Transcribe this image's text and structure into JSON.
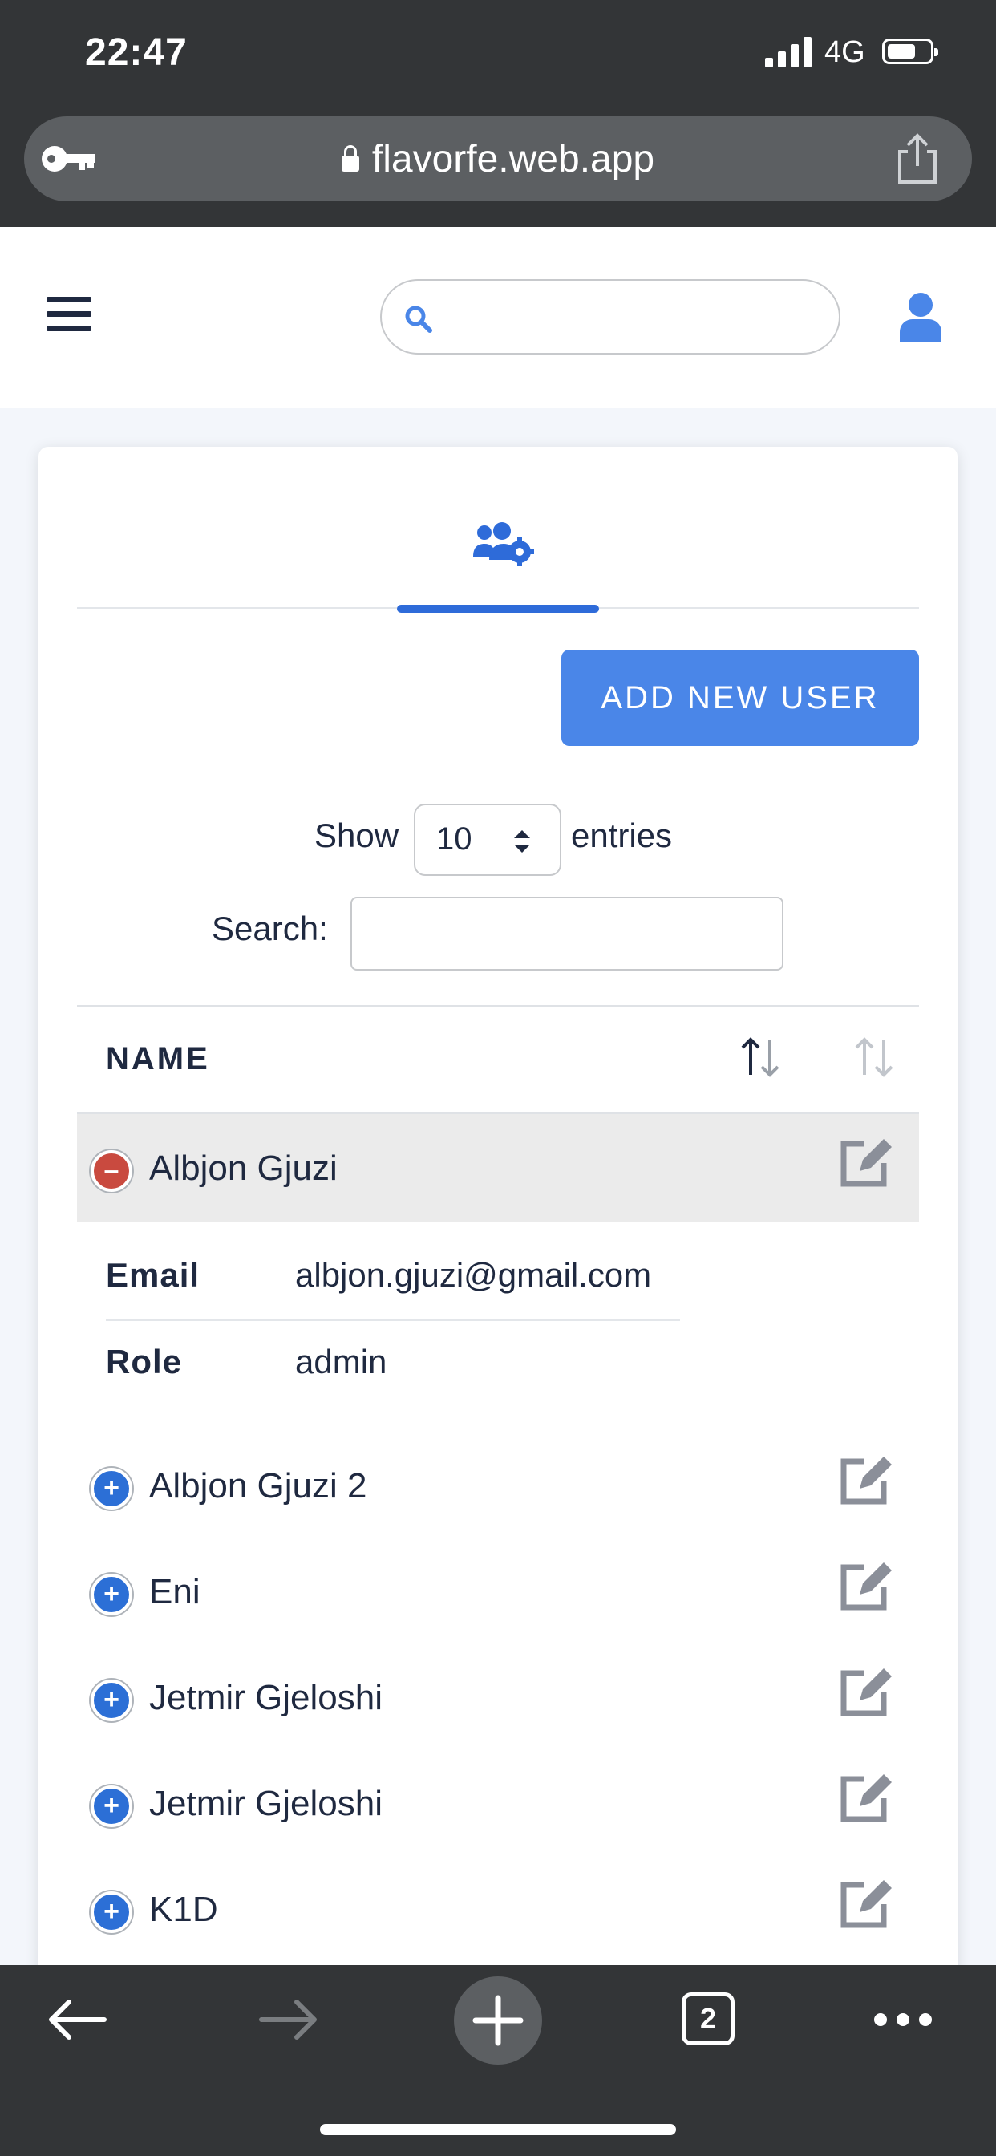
{
  "status_bar": {
    "time": "22:47",
    "network": "4G"
  },
  "browser": {
    "url": "flavorfe.web.app",
    "tab_count": "2"
  },
  "header": {
    "search_placeholder": ""
  },
  "card": {
    "add_button": "ADD NEW USER",
    "length_menu": {
      "show": "Show",
      "value": "10",
      "entries": "entries"
    },
    "filter": {
      "label": "Search:",
      "value": ""
    },
    "table": {
      "column_name": "NAME",
      "expanded_row": {
        "name": "Albjon Gjuzi",
        "email_label": "Email",
        "email": "albjon.gjuzi@gmail.com",
        "role_label": "Role",
        "role": "admin"
      },
      "rows": [
        "Albjon Gjuzi 2",
        "Eni",
        "Jetmir Gjeloshi",
        "Jetmir Gjeloshi",
        "K1D"
      ]
    }
  },
  "colors": {
    "accent": "#4a86e8",
    "active_tab": "#2e6bd9",
    "collapse_toggle": "#c94a3f",
    "expand_toggle": "#2c6fd6"
  }
}
